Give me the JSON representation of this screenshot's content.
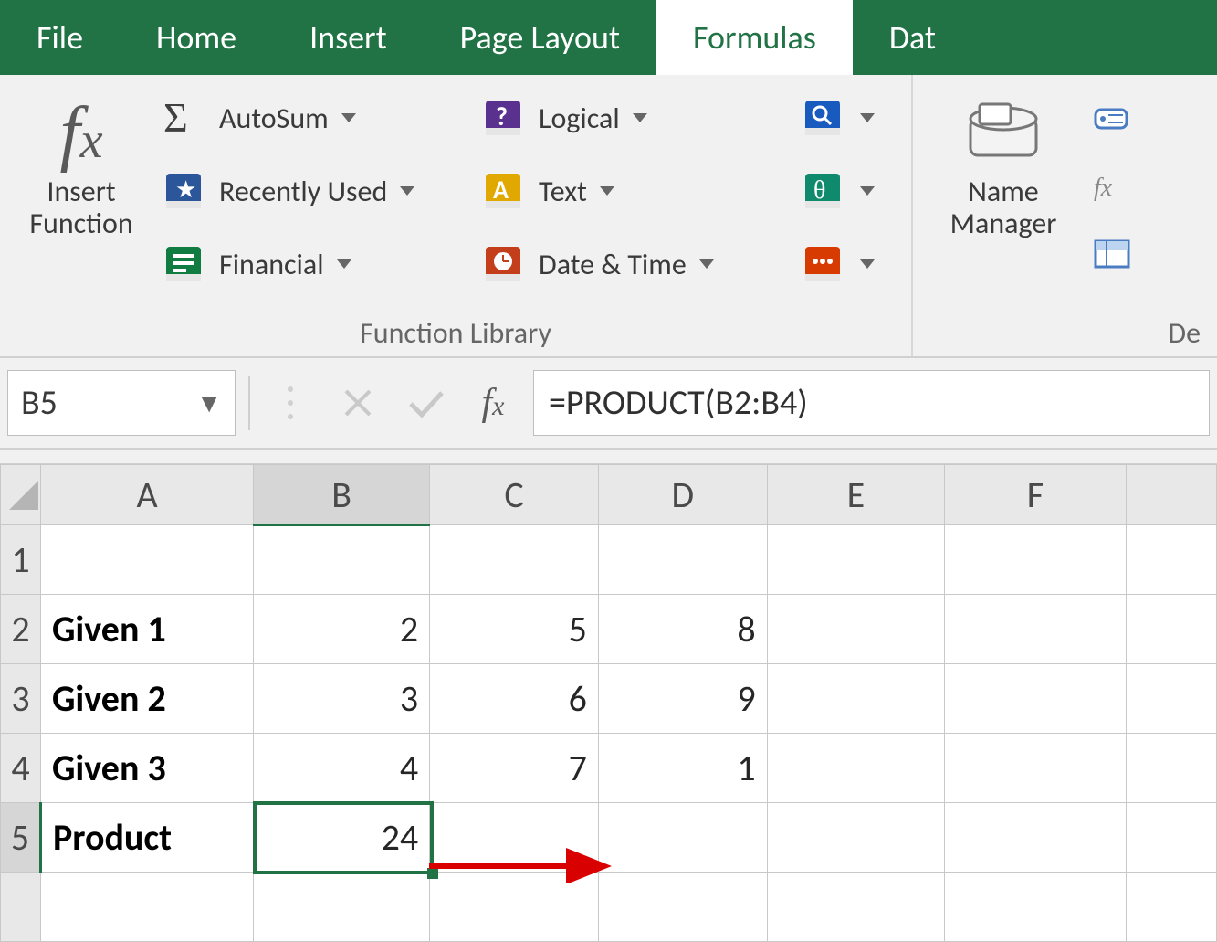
{
  "tabs": {
    "file": "File",
    "home": "Home",
    "insert": "Insert",
    "page_layout": "Page Layout",
    "formulas": "Formulas",
    "data_partial": "Dat"
  },
  "ribbon": {
    "insert_function": {
      "line1": "Insert",
      "line2": "Function"
    },
    "library": {
      "autosum": "AutoSum",
      "recently_used": "Recently Used",
      "financial": "Financial",
      "logical": "Logical",
      "text": "Text",
      "date_time": "Date & Time",
      "group_label": "Function Library"
    },
    "name_manager": {
      "line1": "Name",
      "line2": "Manager"
    },
    "defined_names_label_partial": "De"
  },
  "formula_bar": {
    "name_box": "B5",
    "formula": "=PRODUCT(B2:B4)"
  },
  "grid": {
    "columns": [
      "A",
      "B",
      "C",
      "D",
      "E",
      "F"
    ],
    "rows": [
      {
        "n": "1",
        "a": "",
        "b": "",
        "c": "",
        "d": "",
        "e": "",
        "f": ""
      },
      {
        "n": "2",
        "a": "Given 1",
        "b": "2",
        "c": "5",
        "d": "8",
        "e": "",
        "f": ""
      },
      {
        "n": "3",
        "a": "Given 2",
        "b": "3",
        "c": "6",
        "d": "9",
        "e": "",
        "f": ""
      },
      {
        "n": "4",
        "a": "Given 3",
        "b": "4",
        "c": "7",
        "d": "1",
        "e": "",
        "f": ""
      },
      {
        "n": "5",
        "a": "Product",
        "b": "24",
        "c": "",
        "d": "",
        "e": "",
        "f": ""
      }
    ],
    "selected_col": "B",
    "selected_row": "5"
  }
}
